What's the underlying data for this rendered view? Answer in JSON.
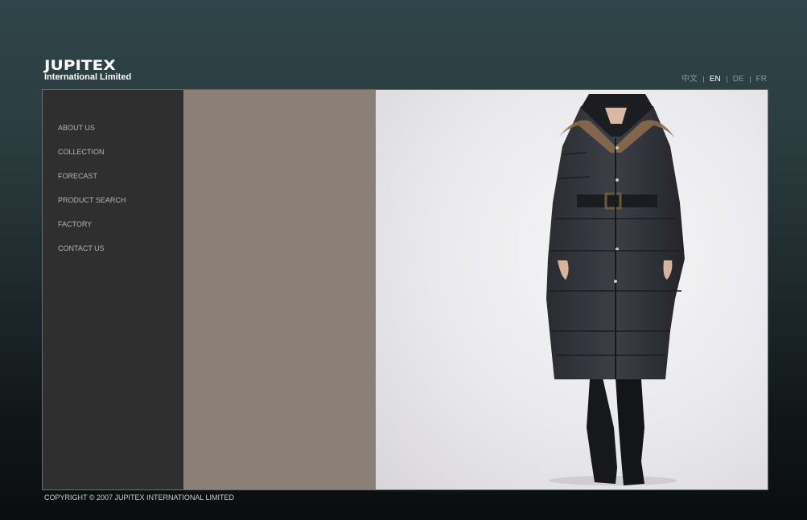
{
  "brand": {
    "name": "JUPITEX",
    "subtitle": "International Limited"
  },
  "languages": [
    {
      "label": "中文",
      "active": false
    },
    {
      "label": "EN",
      "active": true
    },
    {
      "label": "DE",
      "active": false
    },
    {
      "label": "FR",
      "active": false
    }
  ],
  "nav": {
    "items": [
      {
        "label": "ABOUT US"
      },
      {
        "label": "COLLECTION"
      },
      {
        "label": "FORECAST"
      },
      {
        "label": "PRODUCT SEARCH"
      },
      {
        "label": "FACTORY"
      },
      {
        "label": "CONTACT US"
      }
    ]
  },
  "colors": {
    "background_top": "#2f4549",
    "background_bottom": "#0a0d0e",
    "sidebar": "#2f2f2f",
    "panel": "#8b8077",
    "nav_text": "#b3b3b3",
    "active_language": "#ffffff"
  },
  "hero": {
    "icon": "model-in-black-down-coat"
  },
  "footer": {
    "copyright": "COPYRIGHT © 2007 JUPITEX INTERNATIONAL LIMITED"
  }
}
